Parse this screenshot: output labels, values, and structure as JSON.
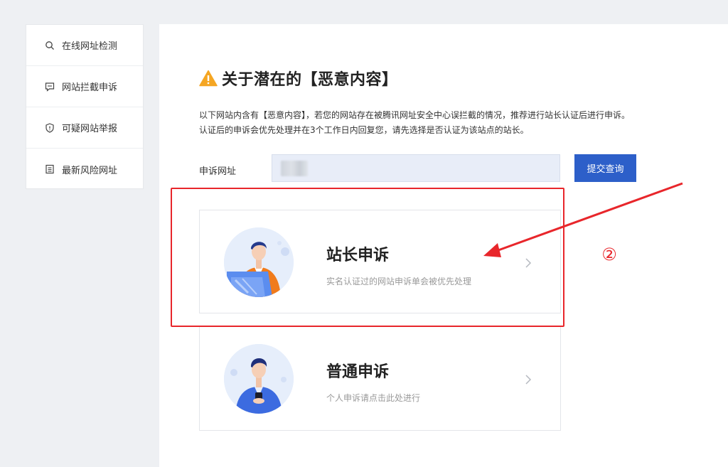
{
  "sidebar": {
    "items": [
      {
        "label": "在线网址检测",
        "icon": "search-icon"
      },
      {
        "label": "网站拦截申诉",
        "icon": "message-icon"
      },
      {
        "label": "可疑网站举报",
        "icon": "shield-icon"
      },
      {
        "label": "最新风险网址",
        "icon": "document-list-icon"
      }
    ]
  },
  "main": {
    "title": "关于潜在的【恶意内容】",
    "description_line1": "以下网站内含有【恶意内容】，若您的网站存在被腾讯网址安全中心误拦截的情况，推荐进行站长认证后进行申诉。",
    "description_line2": "认证后的申诉会优先处理并在3个工作日内回复您，请先选择是否认证为该站点的站长。",
    "url_label": "申诉网址",
    "url_value": "",
    "submit_label": "提交查询"
  },
  "cards": [
    {
      "title": "站长申诉",
      "subtitle": "实名认证过的网站申诉单会被优先处理"
    },
    {
      "title": "普通申诉",
      "subtitle": "个人申诉请点击此处进行"
    }
  ],
  "annotation": {
    "step": "②",
    "color": "#e8262b"
  },
  "colors": {
    "accent": "#2d5fc9",
    "warning": "#f5a623"
  }
}
